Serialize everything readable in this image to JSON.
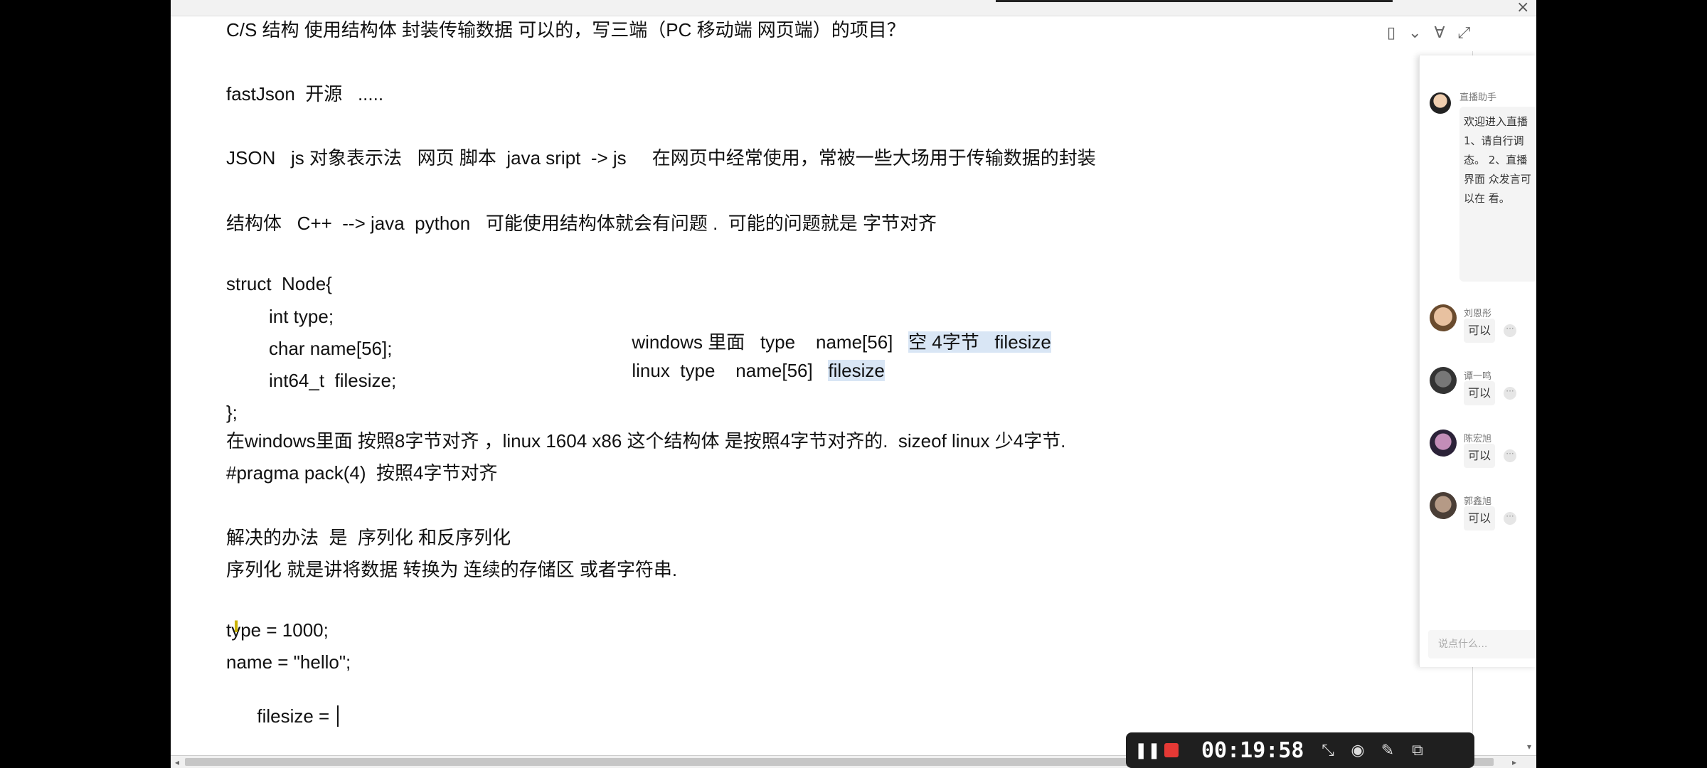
{
  "document": {
    "lines": [
      {
        "text": "C/S 结构 使用结构体 封装传输数据 可以的，写三端（PC 移动端 网页端）的项目？"
      },
      {
        "text": "fastJson  开源   ....."
      },
      {
        "text": "JSON   js 对象表示法   网页 脚本  java sript  -> js     在网页中经常使用，常被一些大场用于传输数据的封装"
      },
      {
        "text": "结构体   C++  --> java  python   可能使用结构体就会有问题 .  可能的问题就是 字节对齐"
      },
      {
        "text": "struct  Node{"
      },
      {
        "text": "int type;"
      },
      {
        "text": "char name[56];"
      },
      {
        "text": "int64_t  filesize;"
      },
      {
        "text": "};"
      },
      {
        "text": "在windows里面 按照8字节对齐 ，linux 1604 x86 这个结构体 是按照4字节对齐的.  sizeof linux 少4字节."
      },
      {
        "text": "#pragma pack(4)  按照4字节对齐"
      },
      {
        "text": "解决的办法  是  序列化 和反序列化"
      },
      {
        "text": "序列化 就是讲将数据 转换为 连续的存储区 或者字符串."
      },
      {
        "text": "type = 1000;"
      },
      {
        "text": "name = \"hello\";"
      },
      {
        "text": "filesize = "
      }
    ],
    "windows_note": {
      "prefix": "windows 里面   type    name[56]   ",
      "highlight": "空 4字节   filesize"
    },
    "linux_note": {
      "prefix": "linux  type    name[56]   ",
      "highlight": "filesize"
    }
  },
  "chat": {
    "host_name": "直播助手",
    "host_message": "欢迎进入直播 1、请自行调 态。 2、直播界面 众发言可以在 看。",
    "messages": [
      {
        "name": "刘恩彤",
        "text": "可以"
      },
      {
        "name": "谭一鸣",
        "text": "可以"
      },
      {
        "name": "陈宏旭",
        "text": "可以"
      },
      {
        "name": "郭鑫旭",
        "text": "可以"
      }
    ],
    "input_placeholder": "说点什么..."
  },
  "recorder": {
    "timer": "00:19:58"
  },
  "colors": {
    "highlight": "#d9e6f5",
    "stop": "#e53935",
    "recorder_bg": "#1f1f1f"
  },
  "icons": {
    "top_handle": "…",
    "close": "×",
    "more": "···",
    "scroll_left": "◂",
    "scroll_right": "▸",
    "scroll_down": "▾",
    "pause": "❚❚",
    "mouse_marker": "I",
    "layout": "▯",
    "dropdown": "⌄",
    "filter": "∀",
    "expand": "⤢",
    "shrink": "⤡",
    "camera": "◉",
    "pen": "✎",
    "window": "⧉"
  }
}
